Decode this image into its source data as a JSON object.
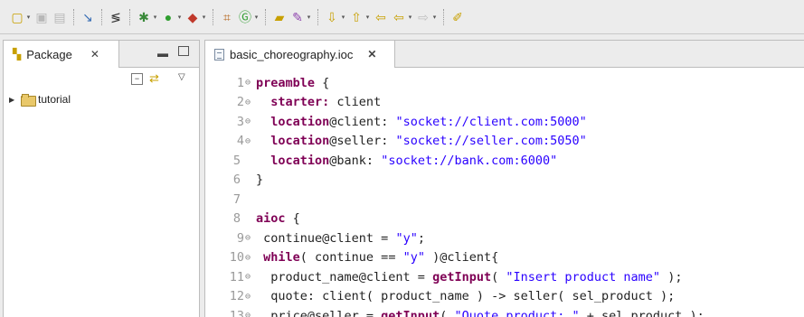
{
  "toolbar": {
    "icons": [
      "new-icon",
      "save-icon",
      "save-all-icon",
      "pin-icon",
      "annotation-icon",
      "debug-icon",
      "run-icon",
      "new-project-icon",
      "wizard-icon",
      "new-class-icon",
      "open-folder-icon",
      "edit-icon",
      "next-annotation-icon",
      "previous-annotation-icon",
      "back-icon",
      "forward-icon",
      "pen-icon"
    ]
  },
  "package_panel": {
    "tab_label": "Package",
    "tree": [
      {
        "label": "tutorial",
        "expanded": false
      }
    ]
  },
  "editor": {
    "tab_label": "basic_choreography.ioc",
    "lines": [
      {
        "n": "1",
        "fold": true,
        "segments": [
          {
            "t": "kw",
            "v": "preamble"
          },
          {
            "t": "plain",
            "v": " {"
          }
        ]
      },
      {
        "n": "2",
        "fold": true,
        "segments": [
          {
            "t": "plain",
            "v": "  "
          },
          {
            "t": "kw",
            "v": "starter:"
          },
          {
            "t": "plain",
            "v": " client"
          }
        ]
      },
      {
        "n": "3",
        "fold": true,
        "segments": [
          {
            "t": "plain",
            "v": "  "
          },
          {
            "t": "kw",
            "v": "location"
          },
          {
            "t": "plain",
            "v": "@client: "
          },
          {
            "t": "str",
            "v": "\"socket://client.com:5000\""
          }
        ]
      },
      {
        "n": "4",
        "fold": true,
        "segments": [
          {
            "t": "plain",
            "v": "  "
          },
          {
            "t": "kw",
            "v": "location"
          },
          {
            "t": "plain",
            "v": "@seller: "
          },
          {
            "t": "str",
            "v": "\"socket://seller.com:5050\""
          }
        ]
      },
      {
        "n": "5",
        "fold": false,
        "segments": [
          {
            "t": "plain",
            "v": "  "
          },
          {
            "t": "kw",
            "v": "location"
          },
          {
            "t": "plain",
            "v": "@bank: "
          },
          {
            "t": "str",
            "v": "\"socket://bank.com:6000\""
          }
        ]
      },
      {
        "n": "6",
        "fold": false,
        "segments": [
          {
            "t": "plain",
            "v": "}"
          }
        ]
      },
      {
        "n": "7",
        "fold": false,
        "segments": []
      },
      {
        "n": "8",
        "fold": false,
        "segments": [
          {
            "t": "kw",
            "v": "aioc"
          },
          {
            "t": "plain",
            "v": " {"
          }
        ]
      },
      {
        "n": "9",
        "fold": true,
        "segments": [
          {
            "t": "plain",
            "v": " continue@client = "
          },
          {
            "t": "str",
            "v": "\"y\""
          },
          {
            "t": "plain",
            "v": ";"
          }
        ]
      },
      {
        "n": "10",
        "fold": true,
        "segments": [
          {
            "t": "plain",
            "v": " "
          },
          {
            "t": "kw",
            "v": "while"
          },
          {
            "t": "plain",
            "v": "( continue == "
          },
          {
            "t": "str",
            "v": "\"y\""
          },
          {
            "t": "plain",
            "v": " )@client{"
          }
        ]
      },
      {
        "n": "11",
        "fold": true,
        "segments": [
          {
            "t": "plain",
            "v": "  product_name@client = "
          },
          {
            "t": "kw",
            "v": "getInput"
          },
          {
            "t": "plain",
            "v": "( "
          },
          {
            "t": "str",
            "v": "\"Insert product name\""
          },
          {
            "t": "plain",
            "v": " );"
          }
        ]
      },
      {
        "n": "12",
        "fold": true,
        "segments": [
          {
            "t": "plain",
            "v": "  quote: client( product_name ) -> seller( sel_product );"
          }
        ]
      },
      {
        "n": "13",
        "fold": true,
        "segments": [
          {
            "t": "plain",
            "v": "  price@seller = "
          },
          {
            "t": "kw",
            "v": "getInput"
          },
          {
            "t": "plain",
            "v": "( "
          },
          {
            "t": "str",
            "v": "\"Quote product: \""
          },
          {
            "t": "plain",
            "v": " + sel_product );"
          }
        ]
      }
    ]
  }
}
